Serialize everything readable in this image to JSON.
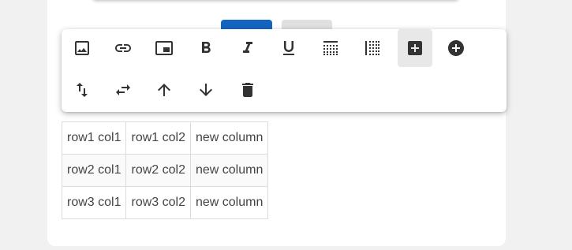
{
  "colors": {
    "icon": "#333333",
    "primary_button": "#1565c0",
    "secondary_button": "#e0e0e0",
    "active_tool_bg": "#e8e8e8",
    "cell_border": "#dcdcdc",
    "cell_text": "#444444"
  },
  "toolbar": {
    "row1": [
      {
        "name": "image-icon"
      },
      {
        "name": "link-icon"
      },
      {
        "name": "picture-in-picture-icon"
      },
      {
        "name": "bold-icon"
      },
      {
        "name": "italic-icon"
      },
      {
        "name": "underline-icon"
      },
      {
        "name": "table-border-horizontal-icon"
      },
      {
        "name": "table-border-vertical-icon"
      },
      {
        "name": "add-box-icon",
        "active": true
      },
      {
        "name": "add-circle-icon"
      }
    ],
    "row2": [
      {
        "name": "swap-vertical-icon"
      },
      {
        "name": "swap-horizontal-icon"
      },
      {
        "name": "arrow-up-icon"
      },
      {
        "name": "arrow-down-icon"
      },
      {
        "name": "delete-icon"
      }
    ]
  },
  "table": {
    "rows": [
      [
        "row1 col1",
        "row1 col2",
        "new column"
      ],
      [
        "row2 col1",
        "row2 col2",
        "new column"
      ],
      [
        "row3 col1",
        "row3 col2",
        "new column"
      ]
    ]
  }
}
